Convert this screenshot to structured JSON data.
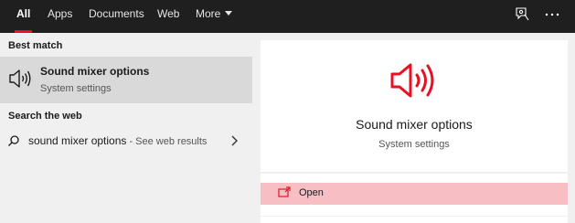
{
  "tabs": [
    {
      "label": "All",
      "active": true
    },
    {
      "label": "Apps"
    },
    {
      "label": "Documents"
    },
    {
      "label": "Web"
    },
    {
      "label": "More"
    }
  ],
  "accent_color": "#e81123",
  "best_match": {
    "heading": "Best match",
    "title": "Sound mixer options",
    "subtitle": "System settings",
    "icon": "speaker-icon"
  },
  "search_web": {
    "heading": "Search the web",
    "query": "sound mixer options",
    "suffix": " - See web results"
  },
  "preview": {
    "title": "Sound mixer options",
    "subtitle": "System settings",
    "actions": [
      {
        "label": "Open",
        "icon": "open-window-icon"
      }
    ]
  }
}
